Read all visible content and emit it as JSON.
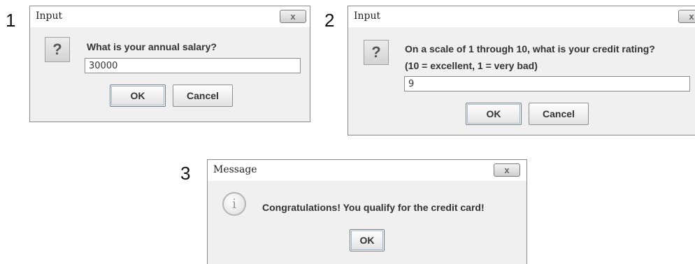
{
  "step_labels": [
    "1",
    "2",
    "3"
  ],
  "dialog1": {
    "title": "Input",
    "icon": "question-icon",
    "prompt": "What is your annual salary?",
    "value": "30000",
    "ok_label": "OK",
    "cancel_label": "Cancel",
    "close_glyph": "x"
  },
  "dialog2": {
    "title": "Input",
    "icon": "question-icon",
    "prompt_line1": "On a scale of 1 through 10, what is your credit rating?",
    "prompt_line2": "(10 = excellent, 1 = very bad)",
    "value": "9",
    "ok_label": "OK",
    "cancel_label": "Cancel",
    "close_glyph": "x"
  },
  "dialog3": {
    "title": "Message",
    "icon": "info-icon",
    "message": "Congratulations! You qualify for the credit card!",
    "ok_label": "OK",
    "close_glyph": "x"
  },
  "icons": {
    "question_glyph": "?",
    "info_glyph": "i"
  }
}
